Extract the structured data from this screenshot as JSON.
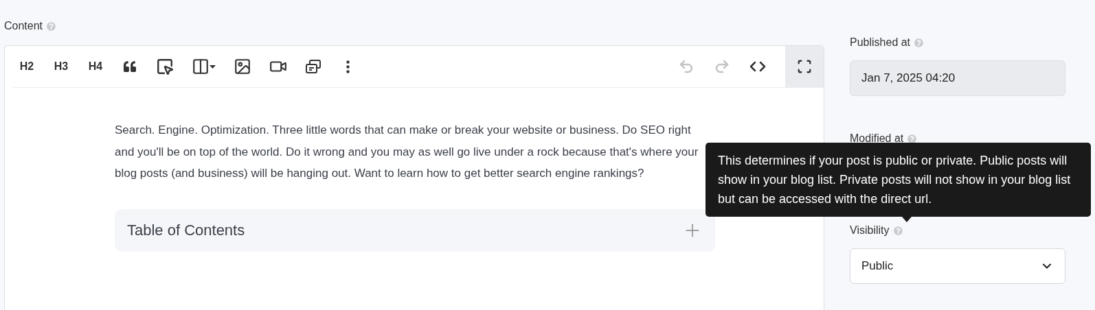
{
  "content_label": "Content",
  "toolbar": {
    "left": [
      {
        "kind": "text",
        "label": "H2"
      },
      {
        "kind": "text",
        "label": "H3"
      },
      {
        "kind": "text",
        "label": "H4"
      },
      {
        "kind": "quote"
      },
      {
        "kind": "select"
      },
      {
        "kind": "columns"
      },
      {
        "kind": "image"
      },
      {
        "kind": "video"
      },
      {
        "kind": "cards"
      },
      {
        "kind": "more"
      }
    ],
    "right": [
      {
        "kind": "undo",
        "disabled": true
      },
      {
        "kind": "redo",
        "disabled": true
      },
      {
        "kind": "code",
        "disabled": false
      }
    ],
    "fullscreen": {
      "active": true
    }
  },
  "body": "Search. Engine. Optimization. Three little words that can make or break your website or business. Do SEO right and you'll be on top of the world. Do it wrong and you may as well go live under a rock because that's where your blog posts (and business) will be hanging out. Want to learn how to get better search engine rankings?",
  "toc": {
    "title": "Table of Contents",
    "expanded": false
  },
  "sidebar": [
    {
      "label": "Published at",
      "kind": "readonly",
      "value": "Jan 7, 2025 04:20"
    },
    {
      "label": "Modified at"
    },
    {
      "label": "Visibility",
      "kind": "select",
      "value": "Public"
    }
  ],
  "tooltip": {
    "text": "This determines if your post is public or private. Public posts will show in your blog list. Private posts will not show in your blog list but can be accessed with the direct url."
  }
}
